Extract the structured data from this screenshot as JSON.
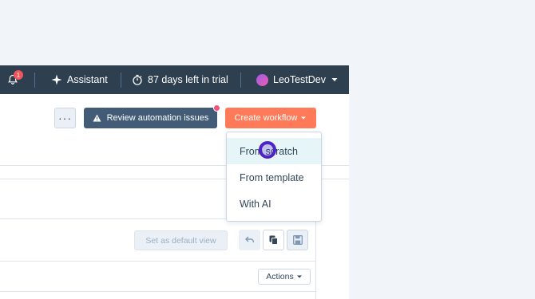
{
  "topbar": {
    "notifications_count": "1",
    "assistant_label": "Assistant",
    "trial_label": "87 days left in trial",
    "user_name": "LeoTestDev"
  },
  "toolbar": {
    "more_label": "···",
    "review_label": "Review automation issues",
    "create_label": "Create workflow"
  },
  "dropdown": {
    "items": [
      {
        "label": "From scratch"
      },
      {
        "label": "From template"
      },
      {
        "label": "With AI"
      }
    ]
  },
  "view_controls": {
    "default_view_label": "Set as default view"
  },
  "table": {
    "actions_label": "Actions"
  },
  "icons": {
    "bell": "bell-icon",
    "assistant": "sparkle-icon",
    "trial": "timer-icon",
    "caret": "caret-down-icon",
    "warning": "warning-icon",
    "undo": "undo-icon",
    "copy": "copy-icon",
    "save": "save-icon"
  }
}
